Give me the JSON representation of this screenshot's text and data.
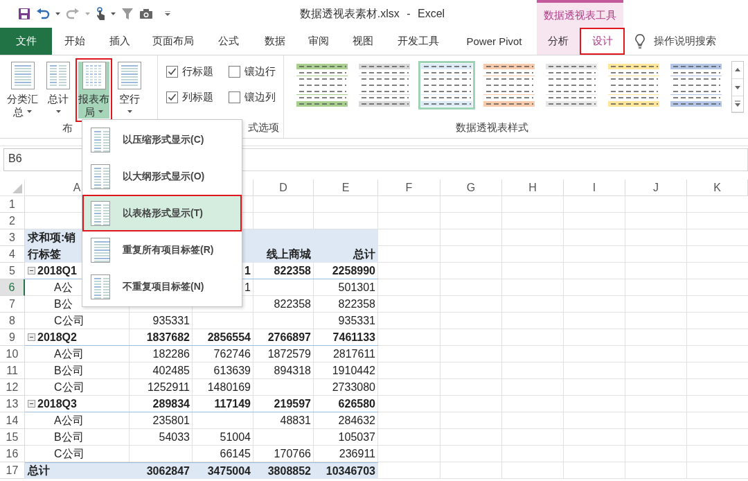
{
  "titlebar": {
    "title": "数据透视表素材.xlsx - Excel",
    "context_label": "数据透视表工具"
  },
  "tabs": [
    {
      "label": "文件",
      "kind": "file",
      "selected": false,
      "highlighted": false
    },
    {
      "label": "开始",
      "kind": "normal",
      "selected": false,
      "highlighted": false
    },
    {
      "label": "插入",
      "kind": "normal",
      "selected": false,
      "highlighted": false
    },
    {
      "label": "页面布局",
      "kind": "normal",
      "selected": false,
      "highlighted": false
    },
    {
      "label": "公式",
      "kind": "normal",
      "selected": false,
      "highlighted": false
    },
    {
      "label": "数据",
      "kind": "normal",
      "selected": false,
      "highlighted": false
    },
    {
      "label": "审阅",
      "kind": "normal",
      "selected": false,
      "highlighted": false
    },
    {
      "label": "视图",
      "kind": "normal",
      "selected": false,
      "highlighted": false
    },
    {
      "label": "开发工具",
      "kind": "normal",
      "selected": false,
      "highlighted": false
    },
    {
      "label": "Power Pivot",
      "kind": "normal",
      "selected": false,
      "highlighted": false
    },
    {
      "label": "分析",
      "kind": "context",
      "selected": false,
      "highlighted": false
    },
    {
      "label": "设计",
      "kind": "context",
      "selected": true,
      "highlighted": true
    }
  ],
  "tell_me": "操作说明搜索",
  "ribbon": {
    "layout_group": {
      "label": "布",
      "buttons": [
        {
          "lines": [
            "分类汇",
            "总"
          ],
          "pressed": false,
          "highlighted": false
        },
        {
          "lines": [
            "总计"
          ],
          "pressed": false,
          "highlighted": false
        },
        {
          "lines": [
            "报表布",
            "局"
          ],
          "pressed": true,
          "highlighted": true
        },
        {
          "lines": [
            "空行"
          ],
          "pressed": false,
          "highlighted": false
        }
      ]
    },
    "options_group": {
      "label": "式选项",
      "checkboxes": [
        {
          "label": "行标题",
          "checked": true
        },
        {
          "label": "镶边行",
          "checked": false
        },
        {
          "label": "列标题",
          "checked": true
        },
        {
          "label": "镶边列",
          "checked": false
        }
      ]
    },
    "styles_group": {
      "label": "数据透视表样式",
      "styles": [
        {
          "color": "#a9d08e",
          "selected": false
        },
        {
          "color": "#d9d9d9",
          "selected": false
        },
        {
          "color": "#ddebf7",
          "selected": true
        },
        {
          "color": "#f8cbad",
          "selected": false
        },
        {
          "color": "#e7e6e6",
          "selected": false
        },
        {
          "color": "#ffe699",
          "selected": false
        },
        {
          "color": "#b4c6e7",
          "selected": false
        }
      ]
    }
  },
  "name_box": "B6",
  "layout_menu": {
    "items": [
      {
        "label": "以压缩形式显示(C)",
        "selected": false
      },
      {
        "label": "以大纲形式显示(O)",
        "selected": false
      },
      {
        "label": "以表格形式显示(T)",
        "selected": true
      },
      {
        "label": "重复所有项目标签(R)",
        "selected": false
      },
      {
        "label": "不重复项目标签(N)",
        "selected": false
      }
    ]
  },
  "sheet": {
    "columns": [
      "A",
      null,
      null,
      "D",
      "E",
      "F",
      "G",
      "H",
      "I",
      "J",
      "K"
    ],
    "rows": [
      {
        "number": "1",
        "kind": "blank",
        "selected": false,
        "cells": {}
      },
      {
        "number": "2",
        "kind": "blank",
        "selected": false,
        "cells": {}
      },
      {
        "number": "3",
        "kind": "header",
        "selected": false,
        "cells": {
          "A": "求和项:销"
        }
      },
      {
        "number": "4",
        "kind": "header",
        "selected": false,
        "cells": {
          "A": "行标签",
          "D": "线上商城",
          "E": "总计"
        }
      },
      {
        "number": "5",
        "kind": "group",
        "expanded": true,
        "selected": false,
        "cells": {
          "A": "2018Q1",
          "C": "1",
          "D": "822358",
          "E": "2258990"
        }
      },
      {
        "number": "6",
        "kind": "item",
        "selected": true,
        "cells": {
          "A": "A公",
          "C": "1",
          "E": "501301"
        }
      },
      {
        "number": "7",
        "kind": "item",
        "selected": false,
        "cells": {
          "A": "B公",
          "D": "822358",
          "E": "822358"
        }
      },
      {
        "number": "8",
        "kind": "item",
        "selected": false,
        "cells": {
          "A": "C公司",
          "B": "935331",
          "E": "935331"
        }
      },
      {
        "number": "9",
        "kind": "group",
        "expanded": true,
        "selected": false,
        "cells": {
          "A": "2018Q2",
          "B": "1837682",
          "C": "2856554",
          "D": "2766897",
          "E": "7461133"
        }
      },
      {
        "number": "10",
        "kind": "item",
        "selected": false,
        "cells": {
          "A": "A公司",
          "B": "182286",
          "C": "762746",
          "D": "1872579",
          "E": "2817611"
        }
      },
      {
        "number": "11",
        "kind": "item",
        "selected": false,
        "cells": {
          "A": "B公司",
          "B": "402485",
          "C": "613639",
          "D": "894318",
          "E": "1910442"
        }
      },
      {
        "number": "12",
        "kind": "item",
        "selected": false,
        "cells": {
          "A": "C公司",
          "B": "1252911",
          "C": "1480169",
          "E": "2733080"
        }
      },
      {
        "number": "13",
        "kind": "group",
        "expanded": true,
        "selected": false,
        "cells": {
          "A": "2018Q3",
          "B": "289834",
          "C": "117149",
          "D": "219597",
          "E": "626580"
        }
      },
      {
        "number": "14",
        "kind": "item",
        "selected": false,
        "cells": {
          "A": "A公司",
          "B": "235801",
          "D": "48831",
          "E": "284632"
        }
      },
      {
        "number": "15",
        "kind": "item",
        "selected": false,
        "cells": {
          "A": "B公司",
          "B": "54033",
          "C": "51004",
          "E": "105037"
        }
      },
      {
        "number": "16",
        "kind": "item",
        "selected": false,
        "cells": {
          "A": "C公司",
          "C": "66145",
          "D": "170766",
          "E": "236911"
        }
      },
      {
        "number": "17",
        "kind": "total",
        "selected": false,
        "cells": {
          "A": "总计",
          "B": "3062847",
          "C": "3475004",
          "D": "3808852",
          "E": "10346703"
        }
      }
    ]
  }
}
